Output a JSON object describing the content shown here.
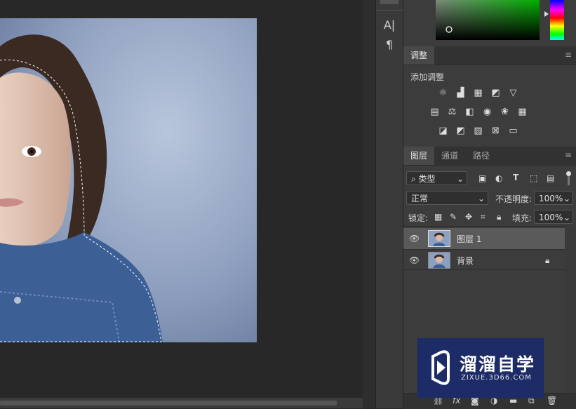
{
  "toolstrip": {
    "text_tool_glyph": "A|",
    "paragraph_glyph": "¶"
  },
  "adjustments": {
    "tab_label": "调整",
    "add_label": "添加调整"
  },
  "layers_panel": {
    "tabs": [
      "图层",
      "通道",
      "路径"
    ],
    "filter_kind": "类型",
    "blend_mode": "正常",
    "opacity_label": "不透明度:",
    "opacity_value": "100%",
    "lock_label": "锁定:",
    "fill_label": "填充:",
    "fill_value": "100%",
    "layers": [
      {
        "name": "图层 1",
        "selected": true,
        "locked": false
      },
      {
        "name": "背景",
        "selected": false,
        "locked": true
      }
    ],
    "bottom_fx": "fx"
  },
  "watermark": {
    "title": "溜溜自学",
    "url": "ZIXUE.3D66.COM"
  },
  "colors": {
    "accent_blue": "#1d2b66",
    "panel_bg": "#3c3c3c",
    "selected_row": "#5a5a5a"
  }
}
